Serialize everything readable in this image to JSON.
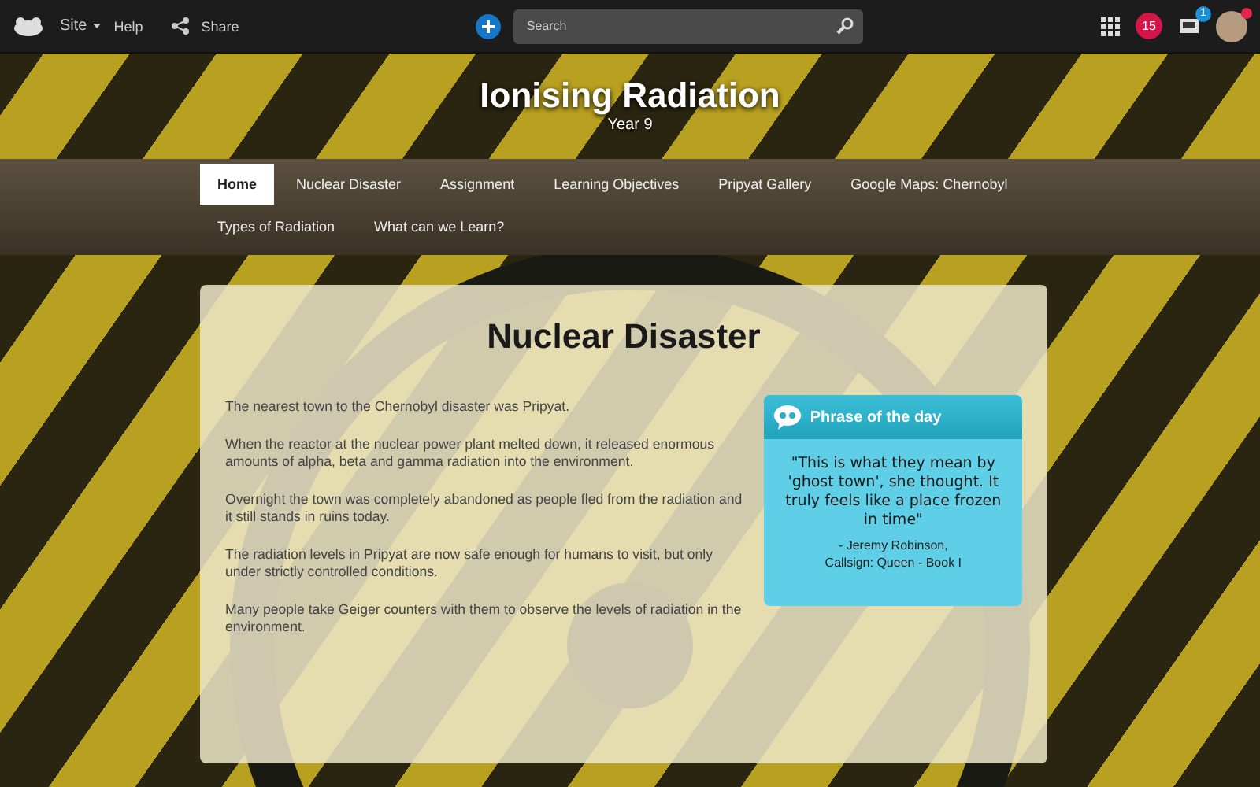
{
  "top_bar": {
    "site_menu": "Site",
    "help": "Help",
    "share": "Share",
    "search": {
      "placeholder": "Search"
    },
    "notifications_count": "15",
    "inbox_count": "1"
  },
  "header": {
    "title": "Ionising Radiation",
    "subtitle": "Year 9"
  },
  "nav": [
    {
      "label": "Home",
      "selected": true
    },
    {
      "label": "Nuclear Disaster",
      "selected": false
    },
    {
      "label": "Assignment",
      "selected": false
    },
    {
      "label": "Learning Objectives",
      "selected": false
    },
    {
      "label": "Pripyat Gallery",
      "selected": false
    },
    {
      "label": "Google Maps: Chernobyl",
      "selected": false
    },
    {
      "label": "Types of Radiation",
      "selected": false
    },
    {
      "label": "What can we Learn?",
      "selected": false
    }
  ],
  "content": {
    "heading": "Nuclear Disaster",
    "paragraphs": [
      "The nearest town to the Chernobyl disaster was Pripyat.",
      "When the reactor at the nuclear power plant melted down, it released enormous amounts of alpha, beta and gamma radiation into the environment.",
      "Overnight the town was completely abandoned as people fled from the radiation and it still stands in ruins today.",
      "The radiation levels in Pripyat are now safe enough for humans to visit, but only under strictly controlled conditions.",
      "Many people take Geiger counters with them to observe the levels of radiation in the environment."
    ],
    "phrase": {
      "title": "Phrase of the day",
      "quote": "\"This is what they mean by 'ghost town', she thought. It truly feels like a place frozen in time\"",
      "attribution": [
        "- Jeremy Robinson,",
        "Callsign: Queen - Book I"
      ]
    }
  }
}
